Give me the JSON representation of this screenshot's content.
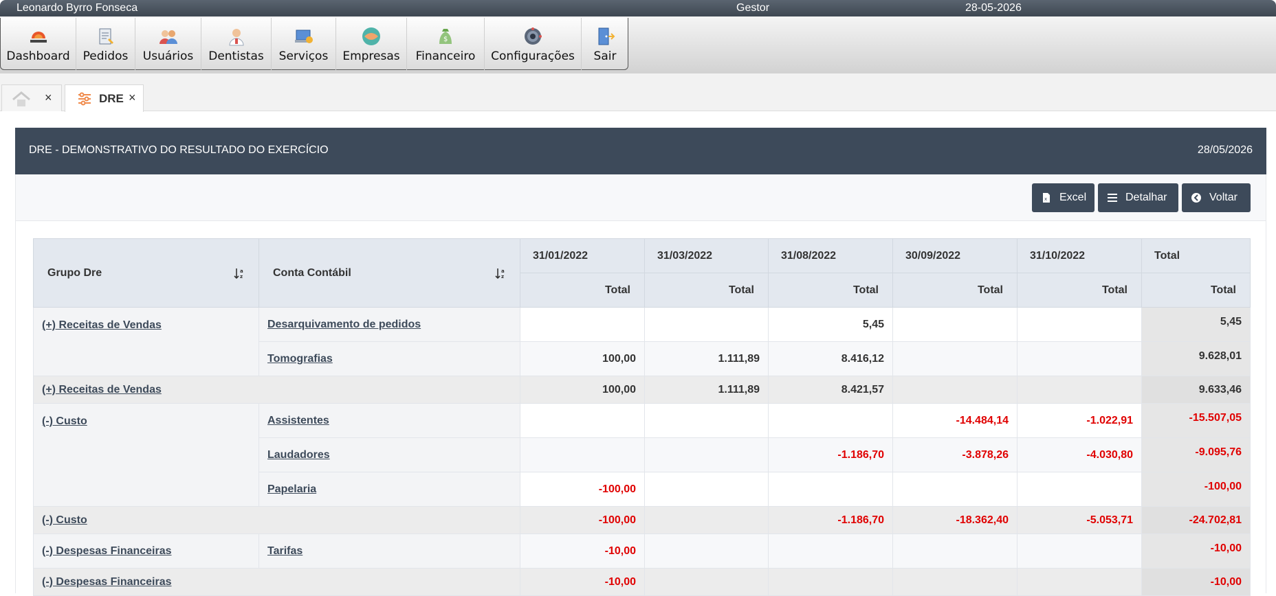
{
  "topbar": {
    "user": "Leonardo Byrro Fonseca",
    "role": "Gestor",
    "date": "28-05-2026"
  },
  "menu": [
    {
      "label": "Dashboard",
      "icon": "diagnosis-logo-icon"
    },
    {
      "label": "Pedidos",
      "icon": "orders-icon"
    },
    {
      "label": "Usuários",
      "icon": "users-icon"
    },
    {
      "label": "Dentistas",
      "icon": "dentist-icon"
    },
    {
      "label": "Serviços",
      "icon": "services-icon"
    },
    {
      "label": "Empresas",
      "icon": "companies-icon"
    },
    {
      "label": "Financeiro",
      "icon": "money-bag-icon"
    },
    {
      "label": "Configurações",
      "icon": "settings-gear-icon"
    },
    {
      "label": "Sair",
      "icon": "exit-door-icon"
    }
  ],
  "tabs": {
    "active_label": "DRE",
    "close_glyph": "×"
  },
  "panel": {
    "title": "DRE - DEMONSTRATIVO DO RESULTADO DO EXERCÍCIO",
    "date": "28/05/2026",
    "buttons": {
      "excel": "Excel",
      "detail": "Detalhar",
      "back": "Voltar"
    }
  },
  "table": {
    "col_group": "Grupo Dre",
    "col_account": "Conta Contábil",
    "periods": [
      "31/01/2022",
      "31/03/2022",
      "31/08/2022",
      "30/09/2022",
      "31/10/2022",
      "Total"
    ],
    "subheader": "Total",
    "rows": [
      {
        "group": "(+) Receitas de Vendas",
        "account": "Desarquivamento de pedidos",
        "values": [
          "",
          "",
          "5,45",
          "",
          ""
        ],
        "total": "5,45"
      },
      {
        "group": "",
        "account": "Tomografias",
        "values": [
          "100,00",
          "1.111,89",
          "8.416,12",
          "",
          ""
        ],
        "total": "9.628,01"
      },
      {
        "subtotal": "(+) Receitas de Vendas",
        "values": [
          "100,00",
          "1.111,89",
          "8.421,57",
          "",
          ""
        ],
        "total": "9.633,46"
      },
      {
        "group": "(-) Custo",
        "account": "Assistentes",
        "values": [
          "",
          "",
          "",
          "-14.484,14",
          "-1.022,91"
        ],
        "total": "-15.507,05"
      },
      {
        "group": "",
        "account": "Laudadores",
        "values": [
          "",
          "",
          "-1.186,70",
          "-3.878,26",
          "-4.030,80"
        ],
        "total": "-9.095,76"
      },
      {
        "group": "",
        "account": "Papelaria",
        "values": [
          "-100,00",
          "",
          "",
          "",
          ""
        ],
        "total": "-100,00"
      },
      {
        "subtotal": "(-) Custo",
        "values": [
          "-100,00",
          "",
          "-1.186,70",
          "-18.362,40",
          "-5.053,71"
        ],
        "total": "-24.702,81"
      },
      {
        "group": "(-) Despesas Financeiras",
        "account": "Tarifas",
        "values": [
          "-10,00",
          "",
          "",
          "",
          ""
        ],
        "total": "-10,00"
      },
      {
        "subtotal": "(-) Despesas Financeiras",
        "values": [
          "-10,00",
          "",
          "",
          "",
          ""
        ],
        "total": "-10,00"
      }
    ]
  },
  "colors": {
    "header_dark": "#3d4a5a",
    "negative": "#e00000",
    "table_head": "#e3e8ef"
  }
}
